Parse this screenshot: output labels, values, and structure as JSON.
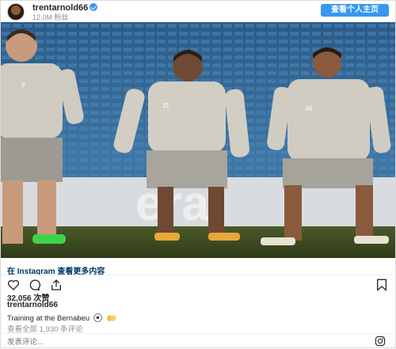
{
  "post": {
    "username": "trentarnold66",
    "followers": "12.0M 粉丝",
    "profile_button": "查看个人主页",
    "instagram_link": "在 Instagram 查看更多内容",
    "likes": "32,056 次赞",
    "caption_user": "trentarnold66",
    "caption_text": "Training at the Bernabeu",
    "comments_link": "查看全部 1,930 条评论",
    "comment_placeholder": "发表评论..."
  },
  "photo": {
    "players": [
      {
        "number": "9"
      },
      {
        "number": "31"
      },
      {
        "number": "48"
      }
    ]
  },
  "colors": {
    "accent": "#3897f0",
    "link": "#003569",
    "muted": "#8e8e8e"
  },
  "icons": [
    "heart-icon",
    "comment-icon",
    "share-icon",
    "bookmark-icon",
    "instagram-glyph-icon",
    "verified-badge-icon",
    "football-emoji-icon",
    "clapping-hands-emoji-icon"
  ]
}
